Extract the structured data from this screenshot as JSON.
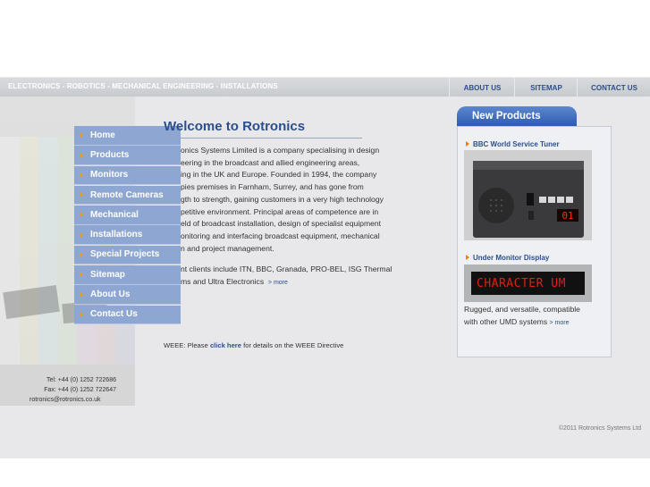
{
  "header": {
    "tagline": "ELECTRONICS - ROBOTICS - MECHANICAL ENGINEERING - INSTALLATIONS",
    "nav": [
      "ABOUT US",
      "SITEMAP",
      "CONTACT US"
    ]
  },
  "menu": [
    "Home",
    "Products",
    "Monitors",
    "Remote Cameras",
    "Mechanical",
    "Installations",
    "Special Projects",
    "Sitemap",
    "About Us",
    "Contact Us"
  ],
  "main": {
    "title": "Welcome to Rotronics",
    "para1": "onics Systems Limited is a company specialising in design eering in the broadcast and allied engineering areas, ing in the UK and Europe. Founded in 1994, the company pies premises in Farnham, Surrey, and has gone from gth to strength, gaining customers in a very high technology petitive environment. Principal areas of competence are in eld of broadcast installation, design of specialist equipment onitoring and interfacing broadcast equipment, mechanical n and project management.",
    "para1_lines": [
      "onics Systems Limited is a company specialising in design",
      "eering in the broadcast and allied engineering areas,",
      "ing in the UK and Europe. Founded in 1994, the company",
      "pies premises in Farnham, Surrey, and has gone from",
      "gth to strength, gaining customers in a very high technology",
      "petitive environment. Principal areas of competence are in",
      "eld of broadcast installation, design of specialist equipment",
      "onitoring and interfacing broadcast equipment, mechanical",
      "n and project management."
    ],
    "para2_lines": [
      "nt clients include ITN, BBC, Granada, PRO-BEL, ISG Thermal",
      "ms and Ultra Electronics"
    ],
    "more": "> more",
    "weee_prefix": "WEEE: Please",
    "weee_link": "click here",
    "weee_suffix": "for details on the WEEE Directive"
  },
  "sidebar_right": {
    "heading": "New Products",
    "product1": "BBC World Service Tuner",
    "tuner_display": "01",
    "product2": "Under Monitor Display",
    "umd_text": "CHARACTER UM",
    "product2_desc_1": "Rugged, and versatile, compatible",
    "product2_desc_2": "with other UMD systems",
    "more": "> more"
  },
  "contact": {
    "tel": "Tel: +44 (0) 1252 722686",
    "fax": "Fax: +44 (0) 1252 722647",
    "email": "rotronics@rotronics.co.uk"
  },
  "footer": {
    "copyright": "©2011 Rotronics Systems Ltd"
  },
  "colors": {
    "accent": "#2b4f8c",
    "menu_bg": "#8ea6d2",
    "arrow": "#f0a000",
    "umd_text": "#e02010"
  }
}
